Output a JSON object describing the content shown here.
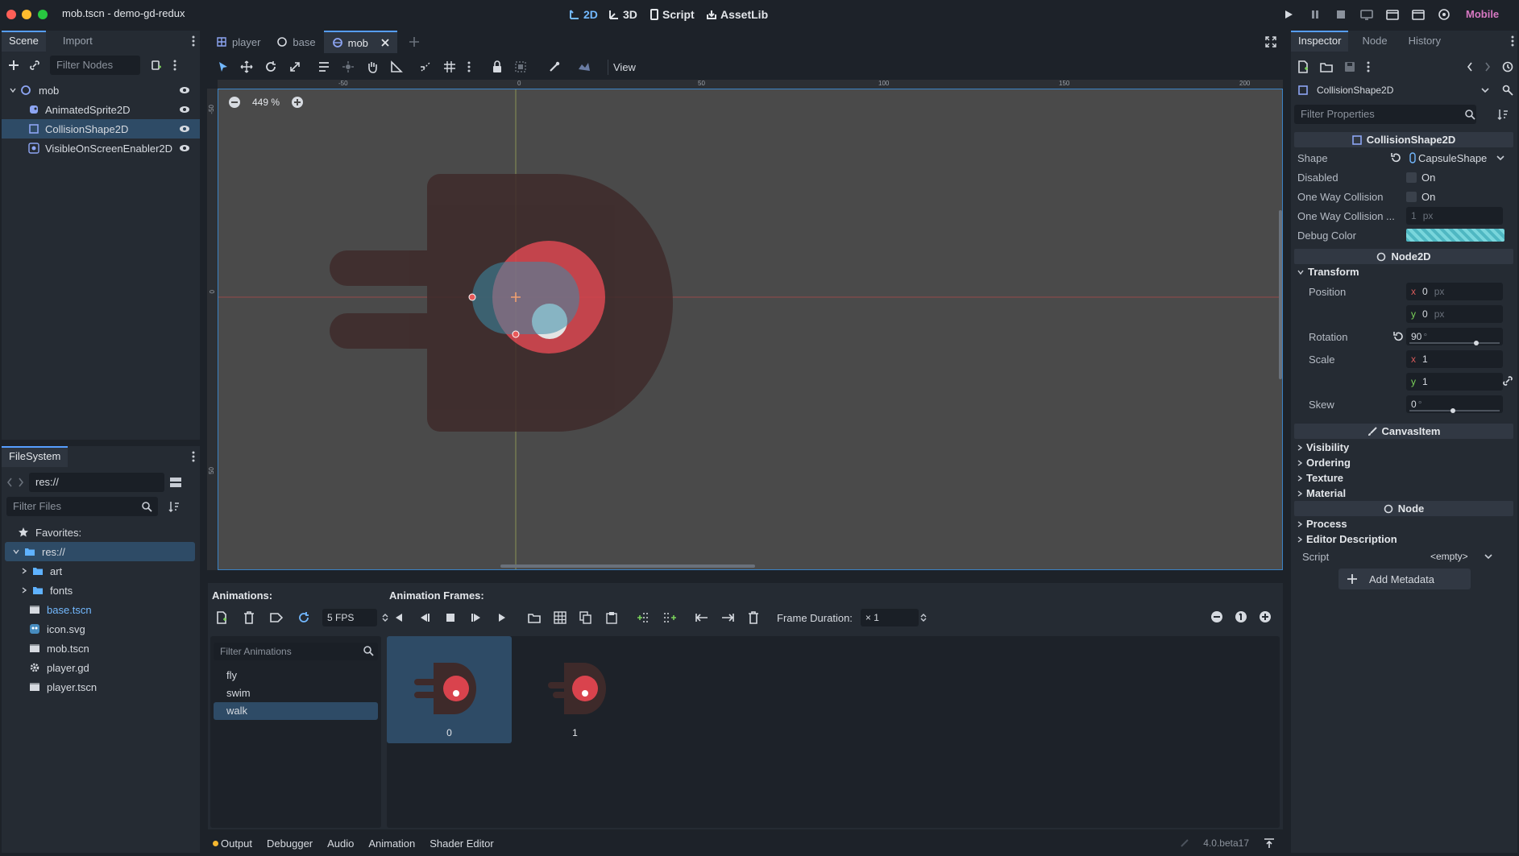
{
  "window": {
    "title": "mob.tscn - demo-gd-redux",
    "renderer": "Mobile"
  },
  "workspaces": [
    {
      "label": "2D",
      "icon": "2d-icon"
    },
    {
      "label": "3D",
      "icon": "3d-icon"
    },
    {
      "label": "Script",
      "icon": "script-icon"
    },
    {
      "label": "AssetLib",
      "icon": "assetlib-icon"
    }
  ],
  "scene_dock": {
    "tabs": [
      "Scene",
      "Import"
    ],
    "filter_placeholder": "Filter Nodes",
    "nodes": [
      {
        "label": "mob",
        "icon": "node2d-icon",
        "color": "#8da5f3"
      },
      {
        "label": "AnimatedSprite2D",
        "icon": "animated-sprite-icon",
        "color": "#8da5f3"
      },
      {
        "label": "CollisionShape2D",
        "icon": "collision-shape-icon",
        "color": "#8da5f3"
      },
      {
        "label": "VisibleOnScreenEnabler2D",
        "icon": "visibility-enabler-icon",
        "color": "#8da5f3"
      }
    ]
  },
  "filesystem_dock": {
    "tab": "FileSystem",
    "path": "res://",
    "filter_placeholder": "Filter Files",
    "favorites_label": "Favorites:",
    "items": [
      {
        "label": "res://",
        "kind": "folder"
      },
      {
        "label": "art",
        "kind": "folder"
      },
      {
        "label": "fonts",
        "kind": "folder"
      },
      {
        "label": "base.tscn",
        "kind": "scene"
      },
      {
        "label": "icon.svg",
        "kind": "image"
      },
      {
        "label": "mob.tscn",
        "kind": "scene"
      },
      {
        "label": "player.gd",
        "kind": "script"
      },
      {
        "label": "player.tscn",
        "kind": "scene"
      }
    ]
  },
  "editor_tabs": [
    {
      "label": "player",
      "icon": "node2d-icon"
    },
    {
      "label": "base",
      "icon": "node2d-icon"
    },
    {
      "label": "mob",
      "icon": "node2d-icon"
    }
  ],
  "toolbar": {
    "view_label": "View"
  },
  "viewport": {
    "zoom": "449 %",
    "ruler_h": [
      "-50",
      "0",
      "50",
      "100",
      "150",
      "200"
    ],
    "ruler_v": [
      "-50",
      "0",
      "50"
    ]
  },
  "animation_panel": {
    "animations_title": "Animations:",
    "frames_title": "Animation Frames:",
    "fps": "5 FPS",
    "filter_placeholder": "Filter Animations",
    "frame_duration_label": "Frame Duration:",
    "frame_duration_value": "× 1",
    "animations": [
      "fly",
      "swim",
      "walk"
    ],
    "frames": [
      "0",
      "1"
    ]
  },
  "bottom_bar": {
    "tabs": [
      "Output",
      "Debugger",
      "Audio",
      "Animation",
      "Shader Editor"
    ],
    "version": "4.0.beta17"
  },
  "inspector": {
    "tabs": [
      "Inspector",
      "Node",
      "History"
    ],
    "selected_node": "CollisionShape2D",
    "filter_placeholder": "Filter Properties",
    "sections": {
      "collision": "CollisionShape2D",
      "node2d": "Node2D",
      "canvas_item": "CanvasItem",
      "node": "Node"
    },
    "props": {
      "shape_label": "Shape",
      "shape_value": "CapsuleShape",
      "disabled_label": "Disabled",
      "disabled_value": "On",
      "one_way_label": "One Way Collision",
      "one_way_value": "On",
      "one_way_margin_label": "One Way Collision ...",
      "one_way_margin_value": "1",
      "one_way_margin_unit": "px",
      "debug_color_label": "Debug Color",
      "transform_label": "Transform",
      "position_label": "Position",
      "position_x": "0",
      "position_y": "0",
      "position_unit": "px",
      "rotation_label": "Rotation",
      "rotation_value": "90",
      "rotation_unit": "°",
      "scale_label": "Scale",
      "scale_x": "1",
      "scale_y": "1",
      "skew_label": "Skew",
      "skew_value": "0",
      "skew_unit": "°",
      "x_axis": "x",
      "y_axis": "y"
    },
    "categories_canvas": [
      "Visibility",
      "Ordering",
      "Texture",
      "Material"
    ],
    "categories_node": [
      "Process",
      "Editor Description"
    ],
    "script_label": "Script",
    "script_value": "<empty>",
    "add_metadata": "Add Metadata"
  }
}
